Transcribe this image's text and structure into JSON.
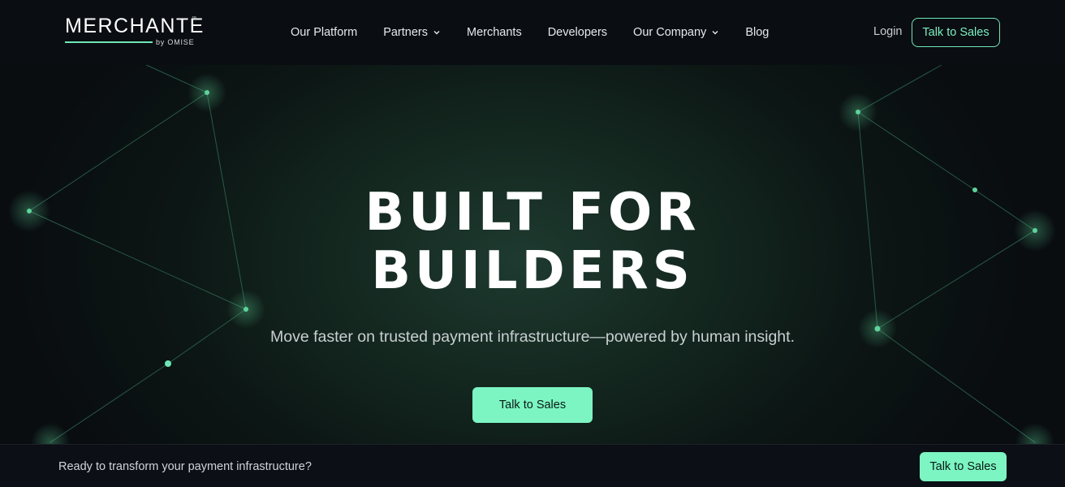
{
  "logo": {
    "word": "MERCHANTE",
    "tm": "™",
    "by": "by OMISE"
  },
  "nav": {
    "items": [
      {
        "label": "Our Platform",
        "has_dropdown": false
      },
      {
        "label": "Partners",
        "has_dropdown": true
      },
      {
        "label": "Merchants",
        "has_dropdown": false
      },
      {
        "label": "Developers",
        "has_dropdown": false
      },
      {
        "label": "Our Company",
        "has_dropdown": true
      },
      {
        "label": "Blog",
        "has_dropdown": false
      }
    ],
    "login": "Login",
    "cta": "Talk to Sales"
  },
  "hero": {
    "headline_line1": "BUILT FOR",
    "headline_line2": "BUILDERS",
    "subtitle": "Move faster on trusted payment infrastructure—powered by human insight.",
    "cta": "Talk to Sales"
  },
  "banner": {
    "text": "Ready to transform your payment infrastructure?",
    "cta": "Talk to Sales"
  },
  "colors": {
    "accent": "#7cf5c2",
    "background": "#0b0e12",
    "node": "#5fd39a"
  }
}
